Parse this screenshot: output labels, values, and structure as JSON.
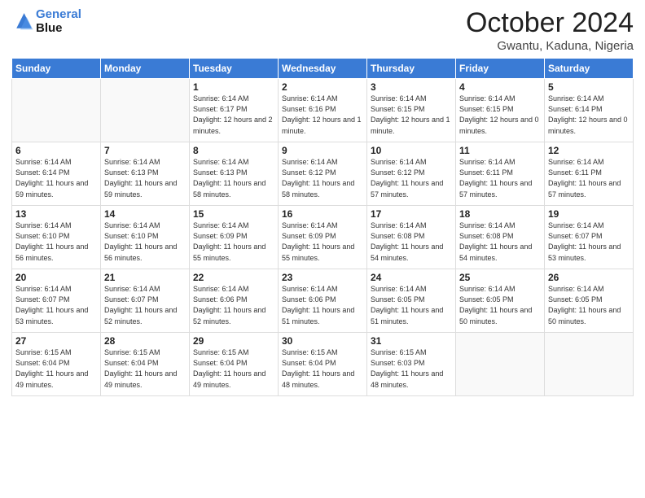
{
  "logo": {
    "line1": "General",
    "line2": "Blue"
  },
  "title": "October 2024",
  "location": "Gwantu, Kaduna, Nigeria",
  "days_header": [
    "Sunday",
    "Monday",
    "Tuesday",
    "Wednesday",
    "Thursday",
    "Friday",
    "Saturday"
  ],
  "weeks": [
    [
      {
        "day": "",
        "info": ""
      },
      {
        "day": "",
        "info": ""
      },
      {
        "day": "1",
        "info": "Sunrise: 6:14 AM\nSunset: 6:17 PM\nDaylight: 12 hours\nand 2 minutes."
      },
      {
        "day": "2",
        "info": "Sunrise: 6:14 AM\nSunset: 6:16 PM\nDaylight: 12 hours\nand 1 minute."
      },
      {
        "day": "3",
        "info": "Sunrise: 6:14 AM\nSunset: 6:15 PM\nDaylight: 12 hours\nand 1 minute."
      },
      {
        "day": "4",
        "info": "Sunrise: 6:14 AM\nSunset: 6:15 PM\nDaylight: 12 hours\nand 0 minutes."
      },
      {
        "day": "5",
        "info": "Sunrise: 6:14 AM\nSunset: 6:14 PM\nDaylight: 12 hours\nand 0 minutes."
      }
    ],
    [
      {
        "day": "6",
        "info": "Sunrise: 6:14 AM\nSunset: 6:14 PM\nDaylight: 11 hours\nand 59 minutes."
      },
      {
        "day": "7",
        "info": "Sunrise: 6:14 AM\nSunset: 6:13 PM\nDaylight: 11 hours\nand 59 minutes."
      },
      {
        "day": "8",
        "info": "Sunrise: 6:14 AM\nSunset: 6:13 PM\nDaylight: 11 hours\nand 58 minutes."
      },
      {
        "day": "9",
        "info": "Sunrise: 6:14 AM\nSunset: 6:12 PM\nDaylight: 11 hours\nand 58 minutes."
      },
      {
        "day": "10",
        "info": "Sunrise: 6:14 AM\nSunset: 6:12 PM\nDaylight: 11 hours\nand 57 minutes."
      },
      {
        "day": "11",
        "info": "Sunrise: 6:14 AM\nSunset: 6:11 PM\nDaylight: 11 hours\nand 57 minutes."
      },
      {
        "day": "12",
        "info": "Sunrise: 6:14 AM\nSunset: 6:11 PM\nDaylight: 11 hours\nand 57 minutes."
      }
    ],
    [
      {
        "day": "13",
        "info": "Sunrise: 6:14 AM\nSunset: 6:10 PM\nDaylight: 11 hours\nand 56 minutes."
      },
      {
        "day": "14",
        "info": "Sunrise: 6:14 AM\nSunset: 6:10 PM\nDaylight: 11 hours\nand 56 minutes."
      },
      {
        "day": "15",
        "info": "Sunrise: 6:14 AM\nSunset: 6:09 PM\nDaylight: 11 hours\nand 55 minutes."
      },
      {
        "day": "16",
        "info": "Sunrise: 6:14 AM\nSunset: 6:09 PM\nDaylight: 11 hours\nand 55 minutes."
      },
      {
        "day": "17",
        "info": "Sunrise: 6:14 AM\nSunset: 6:08 PM\nDaylight: 11 hours\nand 54 minutes."
      },
      {
        "day": "18",
        "info": "Sunrise: 6:14 AM\nSunset: 6:08 PM\nDaylight: 11 hours\nand 54 minutes."
      },
      {
        "day": "19",
        "info": "Sunrise: 6:14 AM\nSunset: 6:07 PM\nDaylight: 11 hours\nand 53 minutes."
      }
    ],
    [
      {
        "day": "20",
        "info": "Sunrise: 6:14 AM\nSunset: 6:07 PM\nDaylight: 11 hours\nand 53 minutes."
      },
      {
        "day": "21",
        "info": "Sunrise: 6:14 AM\nSunset: 6:07 PM\nDaylight: 11 hours\nand 52 minutes."
      },
      {
        "day": "22",
        "info": "Sunrise: 6:14 AM\nSunset: 6:06 PM\nDaylight: 11 hours\nand 52 minutes."
      },
      {
        "day": "23",
        "info": "Sunrise: 6:14 AM\nSunset: 6:06 PM\nDaylight: 11 hours\nand 51 minutes."
      },
      {
        "day": "24",
        "info": "Sunrise: 6:14 AM\nSunset: 6:05 PM\nDaylight: 11 hours\nand 51 minutes."
      },
      {
        "day": "25",
        "info": "Sunrise: 6:14 AM\nSunset: 6:05 PM\nDaylight: 11 hours\nand 50 minutes."
      },
      {
        "day": "26",
        "info": "Sunrise: 6:14 AM\nSunset: 6:05 PM\nDaylight: 11 hours\nand 50 minutes."
      }
    ],
    [
      {
        "day": "27",
        "info": "Sunrise: 6:15 AM\nSunset: 6:04 PM\nDaylight: 11 hours\nand 49 minutes."
      },
      {
        "day": "28",
        "info": "Sunrise: 6:15 AM\nSunset: 6:04 PM\nDaylight: 11 hours\nand 49 minutes."
      },
      {
        "day": "29",
        "info": "Sunrise: 6:15 AM\nSunset: 6:04 PM\nDaylight: 11 hours\nand 49 minutes."
      },
      {
        "day": "30",
        "info": "Sunrise: 6:15 AM\nSunset: 6:04 PM\nDaylight: 11 hours\nand 48 minutes."
      },
      {
        "day": "31",
        "info": "Sunrise: 6:15 AM\nSunset: 6:03 PM\nDaylight: 11 hours\nand 48 minutes."
      },
      {
        "day": "",
        "info": ""
      },
      {
        "day": "",
        "info": ""
      }
    ]
  ]
}
